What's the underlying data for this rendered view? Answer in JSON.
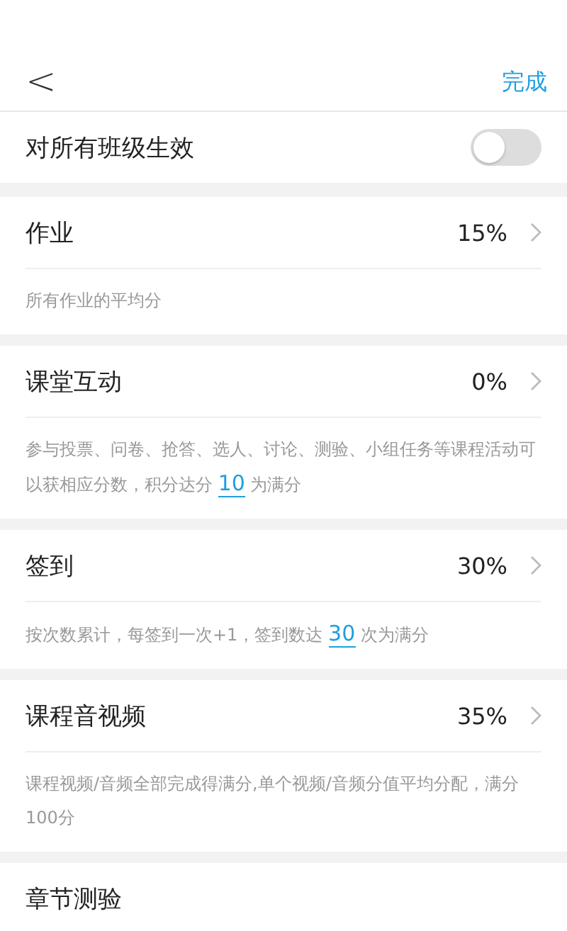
{
  "nav": {
    "back": "<",
    "done": "完成"
  },
  "apply_all": {
    "label": "对所有班级生效",
    "on": false
  },
  "sections": [
    {
      "title": "作业",
      "value": "15%",
      "note": {
        "before": "所有作业的平均分"
      }
    },
    {
      "title": "课堂互动",
      "value": "0%",
      "note": {
        "before": "参与投票、问卷、抢答、选人、讨论、测验、小组任务等课程活动可以获相应分数，积分达分",
        "value": "10",
        "after": "为满分"
      }
    },
    {
      "title": "签到",
      "value": "30%",
      "note": {
        "before": "按次数累计，每签到一次+1，签到数达",
        "value": "30",
        "after": "次为满分"
      }
    },
    {
      "title": "课程音视频",
      "value": "35%",
      "note": {
        "before": "课程视频/音频全部完成得满分,单个视频/音频分值平均分配，满分100分"
      }
    },
    {
      "title": "章节测验"
    }
  ]
}
